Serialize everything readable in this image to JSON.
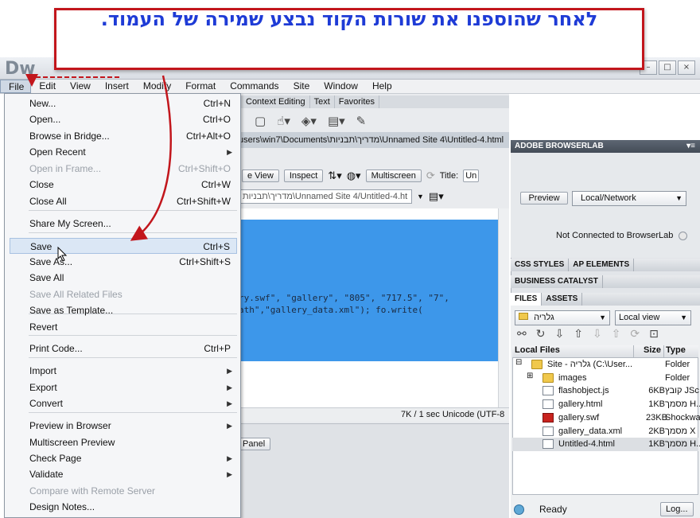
{
  "app": {
    "logo": "Dw",
    "window_buttons": [
      "–",
      "□",
      "×"
    ]
  },
  "callout": {
    "text": "לאחר שהוספנו את שורות הקוד נבצע שמירה של העמוד.",
    "border_color": "#c2161c",
    "text_color": "#1e3bd6"
  },
  "menubar": [
    "File",
    "Edit",
    "View",
    "Insert",
    "Modify",
    "Format",
    "Commands",
    "Site",
    "Window",
    "Help"
  ],
  "file_menu": [
    {
      "label": "New...",
      "shortcut": "Ctrl+N"
    },
    {
      "label": "Open...",
      "shortcut": "Ctrl+O"
    },
    {
      "label": "Browse in Bridge...",
      "shortcut": "Ctrl+Alt+O"
    },
    {
      "label": "Open Recent",
      "submenu": true
    },
    {
      "label": "Open in Frame...",
      "shortcut": "Ctrl+Shift+O",
      "disabled": true
    },
    {
      "label": "Close",
      "shortcut": "Ctrl+W"
    },
    {
      "label": "Close All",
      "shortcut": "Ctrl+Shift+W"
    },
    {
      "label": "Share My Screen..."
    },
    {
      "label": "Save",
      "shortcut": "Ctrl+S",
      "highlighted": true
    },
    {
      "label": "Save As...",
      "shortcut": "Ctrl+Shift+S"
    },
    {
      "label": "Save All"
    },
    {
      "label": "Save All Related Files",
      "disabled": true
    },
    {
      "label": "Save as Template..."
    },
    {
      "label": "Revert"
    },
    {
      "label": "Print Code...",
      "shortcut": "Ctrl+P"
    },
    {
      "label": "Import",
      "submenu": true
    },
    {
      "label": "Export",
      "submenu": true
    },
    {
      "label": "Convert",
      "submenu": true
    },
    {
      "label": "Preview in Browser",
      "submenu": true
    },
    {
      "label": "Multiscreen Preview"
    },
    {
      "label": "Check Page",
      "submenu": true
    },
    {
      "label": "Validate",
      "submenu": true
    },
    {
      "label": "Compare with Remote Server",
      "disabled": true
    },
    {
      "label": "Design Notes..."
    }
  ],
  "insert_tabs": [
    "Context Editing",
    "Text",
    "Favorites"
  ],
  "document": {
    "tab_path": "users\\win7\\Documents\\מדריך\\תבניות\\Unnamed Site 4\\Untitled-4.html",
    "toolbar_buttons": [
      "e View",
      "Inspect",
      "Multiscreen"
    ],
    "title_label": "Title:",
    "title_value": "Un",
    "address": "מדריך\\תבניות\\Unnamed Site 4/Untitled-4.ht",
    "code_lines": [
      "ry.swf\", \"gallery\", \"805\", \"717.5\", \"7\",",
      "ath\",\"gallery_data.xml\"); fo.write("
    ],
    "status": "7K / 1 sec  Unicode (UTF-8",
    "panel_button": "Panel"
  },
  "browserlab": {
    "header": "ADOBE BROWSERLAB",
    "preview_button": "Preview",
    "mode_select": "Local/Network",
    "status": "Not Connected to BrowserLab"
  },
  "panels": {
    "css_tabs": [
      "CSS STYLES",
      "AP ELEMENTS"
    ],
    "business": "BUSINESS CATALYST",
    "files_tabs": [
      "FILES",
      "ASSETS"
    ]
  },
  "files": {
    "site_select": "גלריה",
    "view_select": "Local view",
    "columns": [
      "Local Files",
      "Size",
      "Type"
    ],
    "rows": [
      {
        "name": "Site - גלריה (C:\\User...",
        "size": "",
        "type": "Folder",
        "kind": "folder",
        "indent": 0,
        "expander": "⊟"
      },
      {
        "name": "images",
        "size": "",
        "type": "Folder",
        "kind": "folder",
        "indent": 1,
        "expander": "⊞"
      },
      {
        "name": "flashobject.js",
        "size": "6KB",
        "type": "קובץ JSc",
        "kind": "file",
        "indent": 1,
        "expander": ""
      },
      {
        "name": "gallery.html",
        "size": "1KB",
        "type": "מסמך H...",
        "kind": "file",
        "indent": 1,
        "expander": ""
      },
      {
        "name": "gallery.swf",
        "size": "23KB",
        "type": "Shockwa",
        "kind": "swf",
        "indent": 1,
        "expander": ""
      },
      {
        "name": "gallery_data.xml",
        "size": "2KB",
        "type": "מסמך X",
        "kind": "file",
        "indent": 1,
        "expander": ""
      },
      {
        "name": "Untitled-4.html",
        "size": "1KB",
        "type": "מסמך H...",
        "kind": "file",
        "indent": 1,
        "expander": "",
        "selected": true
      }
    ],
    "status": "Ready",
    "log_button": "Log..."
  }
}
